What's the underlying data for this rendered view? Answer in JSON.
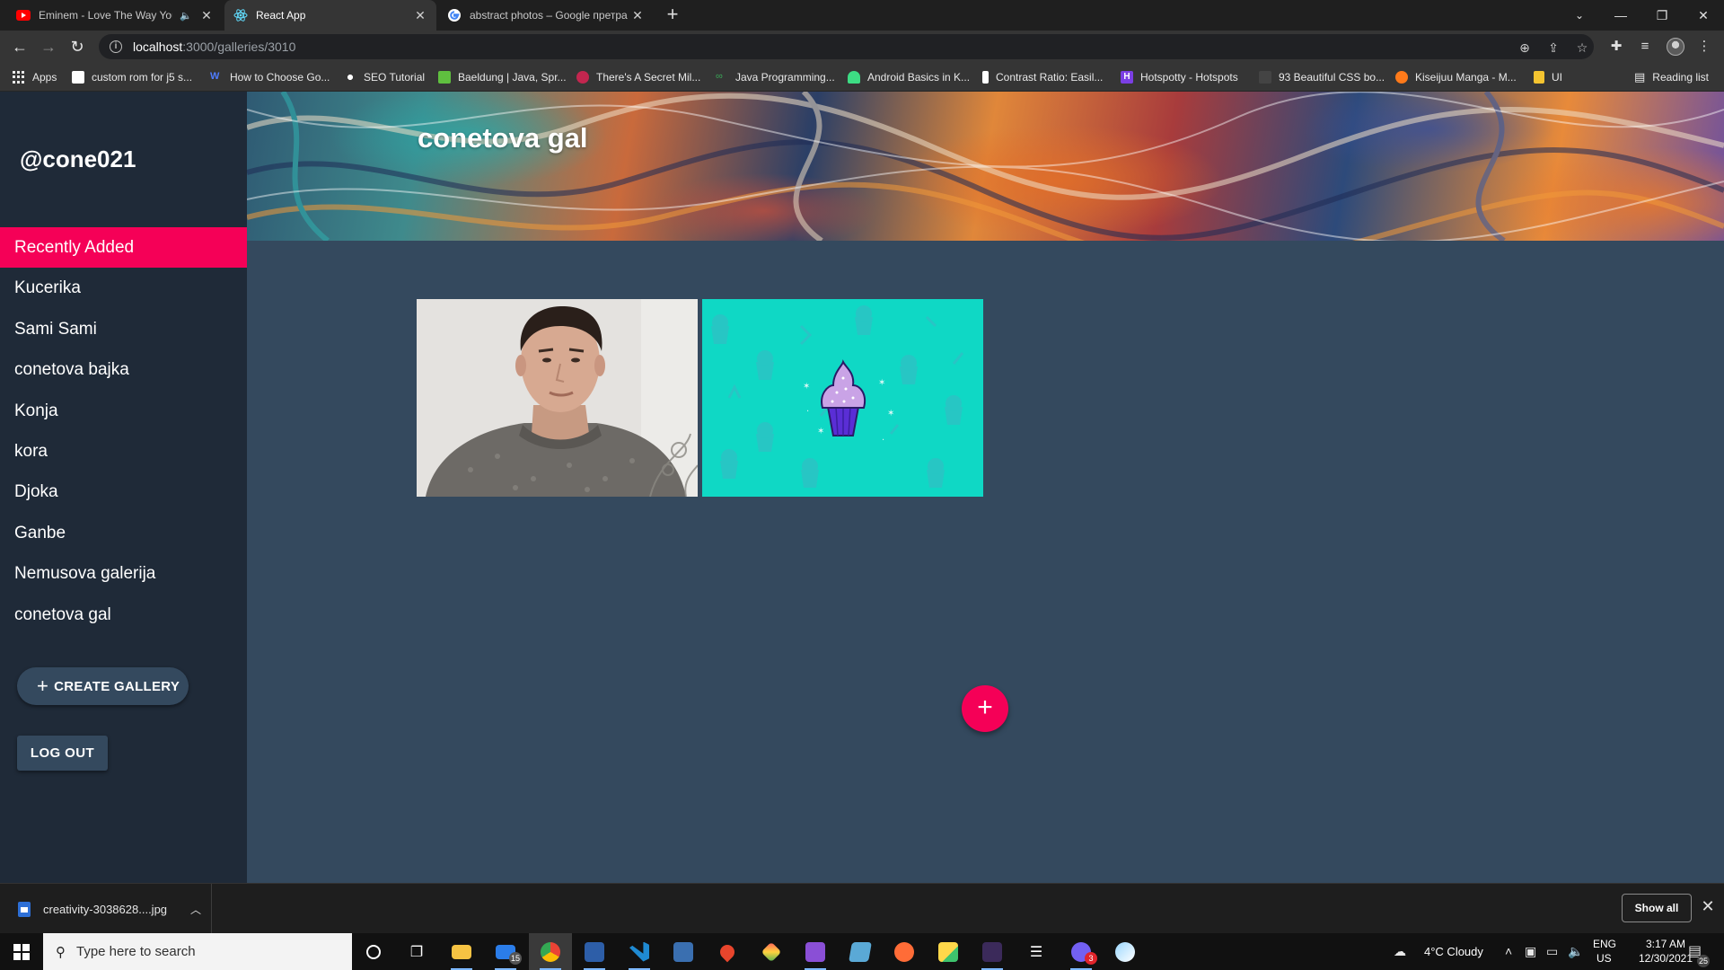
{
  "browser": {
    "tabs": [
      {
        "title": "Eminem - Love The Way You",
        "favicon": "youtube-icon",
        "muted_icon": "speaker-icon",
        "active": false
      },
      {
        "title": "React App",
        "favicon": "react-icon",
        "active": true
      },
      {
        "title": "abstract photos – Google претра",
        "favicon": "google-icon",
        "active": false
      }
    ],
    "url_host": "localhost",
    "url_path": ":3000/galleries/3010",
    "bookmarks": [
      {
        "label": "Apps",
        "icon": "apps-grid-icon"
      },
      {
        "label": "custom rom for j5 s...",
        "icon": "page-icon",
        "color": "#ffffff"
      },
      {
        "label": "How to Choose Go...",
        "icon": "w-icon",
        "color": "#4f7cff"
      },
      {
        "label": "SEO Tutorial",
        "icon": "seo-icon",
        "color": "#ffffff"
      },
      {
        "label": "Baeldung | Java, Spr...",
        "icon": "baeldung-icon",
        "color": "#5fbf3f"
      },
      {
        "label": "There's A Secret Mil...",
        "icon": "raspberry-icon",
        "color": "#c3264f"
      },
      {
        "label": "Java Programming...",
        "icon": "java-icon",
        "color": "#3aa757"
      },
      {
        "label": "Android Basics in K...",
        "icon": "android-icon",
        "color": "#3ddc84"
      },
      {
        "label": "Contrast Ratio: Easil...",
        "icon": "contrast-icon",
        "color": "#ffffff"
      },
      {
        "label": "Hotspotty - Hotspots",
        "icon": "hotspotty-icon",
        "color": "#7b3fe4"
      },
      {
        "label": "93 Beautiful CSS bo...",
        "icon": "css-icon",
        "color": "#444444"
      },
      {
        "label": "Kiseijuu Manga - M...",
        "icon": "manga-icon",
        "color": "#ff7a1a"
      },
      {
        "label": "UI",
        "icon": "folder-icon",
        "color": "#f4c430"
      }
    ],
    "reading_list": "Reading list"
  },
  "app": {
    "username": "@cone021",
    "nav": [
      {
        "label": "Recently Added",
        "active": true
      },
      {
        "label": "Kucerika"
      },
      {
        "label": "Sami Sami"
      },
      {
        "label": "conetova bajka"
      },
      {
        "label": "Konja"
      },
      {
        "label": "kora"
      },
      {
        "label": "Djoka"
      },
      {
        "label": "Ganbe"
      },
      {
        "label": "Nemusova galerija"
      },
      {
        "label": "conetova gal"
      }
    ],
    "create_gallery": "CREATE GALLERY",
    "log_out": "LOG OUT",
    "gallery_title": "conetova gal",
    "images": [
      {
        "alt": "portrait-photo"
      },
      {
        "alt": "cupcake-illustration"
      }
    ],
    "fab_symbol": "+",
    "accent_color": "#f50057",
    "background_color": "#34495e",
    "sidebar_color": "#1f2a38"
  },
  "downloads": {
    "file": "creativity-3038628....jpg",
    "show_all": "Show all"
  },
  "taskbar": {
    "search_placeholder": "Type here to search",
    "mail_badge": "15",
    "viber_badge": "3",
    "weather": "4°C  Cloudy",
    "lang": "ENG",
    "region": "US",
    "time": "3:17 AM",
    "date": "12/30/2021",
    "notif_count": "25"
  }
}
